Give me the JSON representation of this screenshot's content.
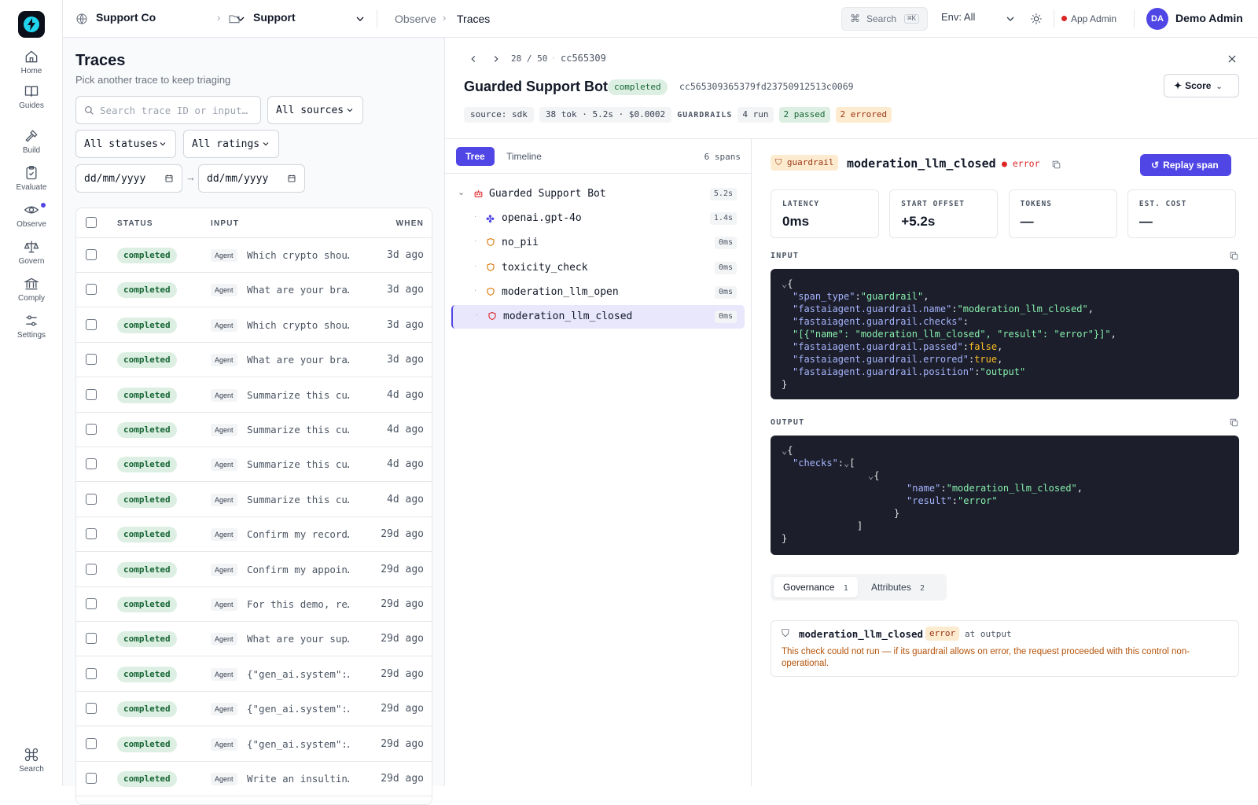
{
  "rail": {
    "items": [
      {
        "label": "Home",
        "icon": "home-icon"
      },
      {
        "label": "Guides",
        "icon": "book-icon"
      },
      {
        "label": "Build",
        "icon": "hammer-icon"
      },
      {
        "label": "Evaluate",
        "icon": "clipboard-check-icon"
      },
      {
        "label": "Observe",
        "icon": "eye-icon"
      },
      {
        "label": "Govern",
        "icon": "scale-icon"
      },
      {
        "label": "Comply",
        "icon": "landmark-icon"
      },
      {
        "label": "Settings",
        "icon": "sliders-icon"
      }
    ],
    "search_label": "Search"
  },
  "topbar": {
    "org": "Support Co",
    "project": "Support",
    "crumb_parent": "Observe",
    "crumb_current": "Traces",
    "search_label": "Search",
    "search_kbd": "⌘K",
    "env_label": "Env: All",
    "role_label": "App Admin",
    "avatar_initials": "DA",
    "user_name": "Demo Admin"
  },
  "list": {
    "title": "Traces",
    "subtitle": "Pick another trace to keep triaging",
    "search_placeholder": "Search trace ID or input…",
    "sources_select": "All sources",
    "statuses_select": "All statuses",
    "ratings_select": "All ratings",
    "date_from": "dd/mm/yyyy",
    "date_to": "dd/mm/yyyy",
    "columns": {
      "status": "STATUS",
      "input": "INPUT",
      "when": "WHEN"
    },
    "rows": [
      {
        "status": "completed",
        "tag": "Agent",
        "input": "Which crypto shou…",
        "when": "3d ago"
      },
      {
        "status": "completed",
        "tag": "Agent",
        "input": "What are your bra…",
        "when": "3d ago"
      },
      {
        "status": "completed",
        "tag": "Agent",
        "input": "Which crypto shou…",
        "when": "3d ago"
      },
      {
        "status": "completed",
        "tag": "Agent",
        "input": "What are your bra…",
        "when": "3d ago"
      },
      {
        "status": "completed",
        "tag": "Agent",
        "input": "Summarize this cu…",
        "when": "4d ago"
      },
      {
        "status": "completed",
        "tag": "Agent",
        "input": "Summarize this cu…",
        "when": "4d ago"
      },
      {
        "status": "completed",
        "tag": "Agent",
        "input": "Summarize this cu…",
        "when": "4d ago"
      },
      {
        "status": "completed",
        "tag": "Agent",
        "input": "Summarize this cu…",
        "when": "4d ago"
      },
      {
        "status": "completed",
        "tag": "Agent",
        "input": "Confirm my record…",
        "when": "29d ago"
      },
      {
        "status": "completed",
        "tag": "Agent",
        "input": "Confirm my appoin…",
        "when": "29d ago"
      },
      {
        "status": "completed",
        "tag": "Agent",
        "input": "For this demo, re…",
        "when": "29d ago"
      },
      {
        "status": "completed",
        "tag": "Agent",
        "input": "What are your sup…",
        "when": "29d ago"
      },
      {
        "status": "completed",
        "tag": "Agent",
        "input": "{\"gen_ai.system\":…",
        "when": "29d ago"
      },
      {
        "status": "completed",
        "tag": "Agent",
        "input": "{\"gen_ai.system\":…",
        "when": "29d ago"
      },
      {
        "status": "completed",
        "tag": "Agent",
        "input": "{\"gen_ai.system\":…",
        "when": "29d ago"
      },
      {
        "status": "completed",
        "tag": "Agent",
        "input": "Write an insultin…",
        "when": "29d ago"
      }
    ]
  },
  "detail": {
    "position": "28 / 50",
    "trace_short": "cc565309",
    "title": "Guarded Support Bot",
    "status": "completed",
    "trace_id": "cc565309365379fd23750912513c0069",
    "score_label": "Score",
    "source_pill": "source: sdk",
    "stats_pill": "38 tok · 5.2s · $0.0002",
    "guardrails_label": "GUARDRAILS",
    "guard_run": "4 run",
    "guard_passed": "2 passed",
    "guard_errored": "2 errored",
    "tabs": {
      "tree": "Tree",
      "timeline": "Timeline"
    },
    "span_count": "6 spans",
    "spans": [
      {
        "name": "Guarded Support Bot",
        "dur": "5.2s",
        "icon": "bot-icon"
      },
      {
        "name": "openai.gpt-4o",
        "dur": "1.4s",
        "icon": "sparkle-icon"
      },
      {
        "name": "no_pii",
        "dur": "0ms",
        "icon": "shield-icon"
      },
      {
        "name": "toxicity_check",
        "dur": "0ms",
        "icon": "shield-icon"
      },
      {
        "name": "moderation_llm_open",
        "dur": "0ms",
        "icon": "shield-icon"
      },
      {
        "name": "moderation_llm_closed",
        "dur": "0ms",
        "icon": "shield-icon"
      }
    ],
    "span": {
      "kind": "guardrail",
      "name": "moderation_llm_closed",
      "status": "error",
      "replay_label": "Replay span",
      "metrics": [
        {
          "label": "LATENCY",
          "value": "0ms"
        },
        {
          "label": "START OFFSET",
          "value": "+5.2s"
        },
        {
          "label": "TOKENS",
          "value": "—"
        },
        {
          "label": "EST. COST",
          "value": "—"
        }
      ],
      "input_label": "INPUT",
      "output_label": "OUTPUT",
      "input_json": {
        "span_type": "guardrail",
        "name": "moderation_llm_closed",
        "checks": "[{\"name\": \"moderation_llm_closed\", \"result\": \"error\"}]",
        "passed": "false",
        "errored": "true",
        "position": "output"
      },
      "output_json": {
        "check_name": "moderation_llm_closed",
        "check_result": "error"
      },
      "sub_tabs": [
        {
          "label": "Governance",
          "count": "1"
        },
        {
          "label": "Attributes",
          "count": "2"
        }
      ],
      "gov_item": {
        "name": "moderation_llm_closed",
        "result": "error",
        "where": "at output",
        "message": "This check could not run — if its guardrail allows on error, the request proceeded with this control non-operational."
      }
    }
  },
  "colors": {
    "accent": "#4f46e5",
    "success_bg": "#dcefe2",
    "success_fg": "#166534",
    "warn_bg": "#fdebd0",
    "warn_fg": "#9a3412",
    "error": "#dc2626",
    "code_bg": "#1c1e2b"
  }
}
